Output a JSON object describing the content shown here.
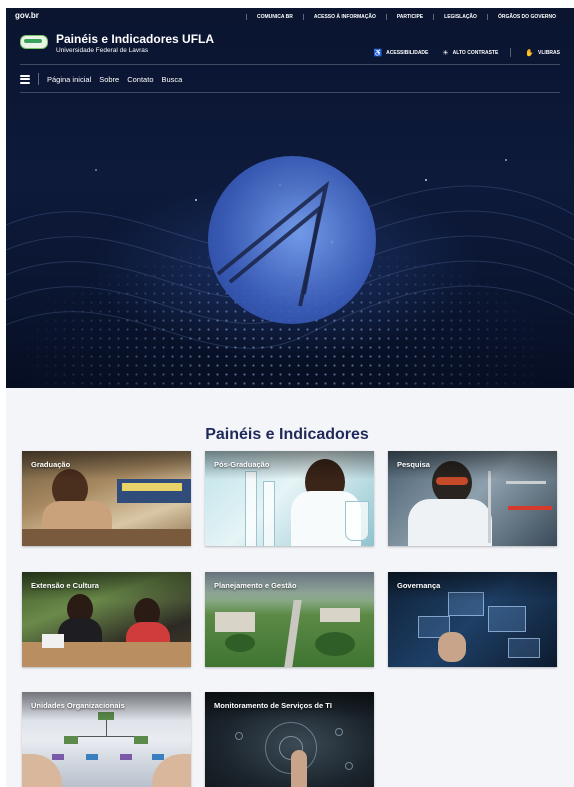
{
  "govbar": {
    "logo": "gov.br",
    "links": [
      "COMUNICA BR",
      "ACESSO À INFORMAÇÃO",
      "PARTICIPE",
      "LEGISLAÇÃO",
      "ÓRGÃOS DO GOVERNO"
    ]
  },
  "brand": {
    "title": "Painéis e Indicadores UFLA",
    "subtitle": "Universidade Federal de Lavras"
  },
  "accessibility": [
    {
      "icon": "accessibility-icon",
      "glyph": "♿",
      "label": "ACESSIBILIDADE"
    },
    {
      "icon": "contrast-icon",
      "glyph": "☀",
      "label": "ALTO CONTRASTE"
    },
    {
      "icon": "vlibras-icon",
      "glyph": "✋",
      "label": "VLIBRAS"
    }
  ],
  "nav": {
    "items": [
      "Página inicial",
      "Sobre",
      "Contato",
      "Busca"
    ]
  },
  "main": {
    "title": "Painéis e Indicadores",
    "cards": [
      {
        "label": "Graduação"
      },
      {
        "label": "Pós-Graduação"
      },
      {
        "label": "Pesquisa"
      },
      {
        "label": "Extensão e Cultura"
      },
      {
        "label": "Planejamento e Gestão"
      },
      {
        "label": "Governança"
      },
      {
        "label": "Unidades Organizacionais"
      },
      {
        "label": "Monitoramento de Serviços de TI"
      }
    ]
  },
  "colors": {
    "header_bg": "#0d1a3a",
    "title": "#1f2a5a",
    "section_bg": "#f4f5f9"
  }
}
